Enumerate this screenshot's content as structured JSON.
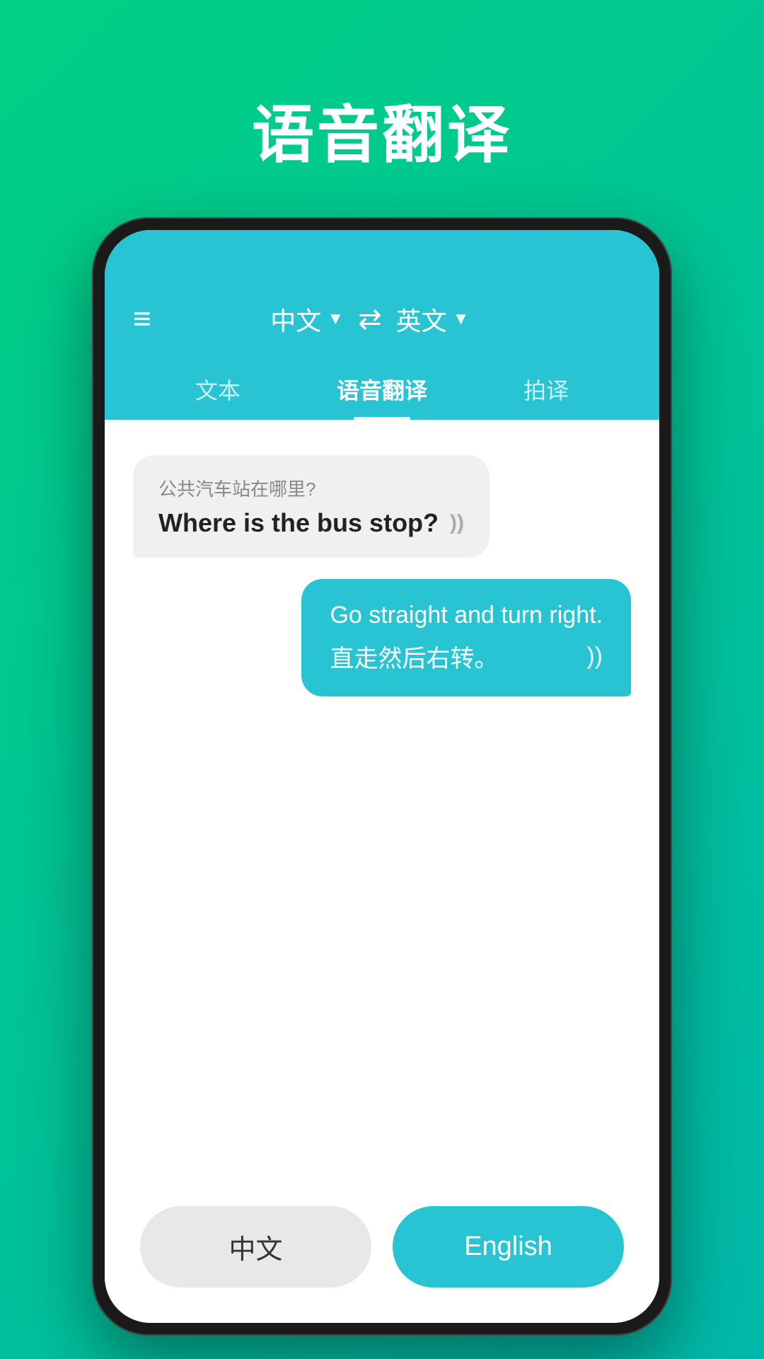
{
  "page": {
    "title": "语音翻译",
    "background_color_start": "#00d084",
    "background_color_end": "#00b8a9"
  },
  "header": {
    "source_lang": "中文",
    "target_lang": "英文",
    "dropdown_arrow": "▼",
    "swap_label": "swap-icon"
  },
  "tabs": [
    {
      "id": "text",
      "label": "文本",
      "active": false
    },
    {
      "id": "voice",
      "label": "语音翻译",
      "active": true
    },
    {
      "id": "photo",
      "label": "拍译",
      "active": false
    }
  ],
  "messages": [
    {
      "id": "msg1",
      "direction": "left",
      "source_text": "公共汽车站在哪里?",
      "translated_text": "Where is the bus stop?",
      "has_sound": true
    },
    {
      "id": "msg2",
      "direction": "right",
      "source_text": "Go straight and turn right.",
      "translated_text": "直走然后右转。",
      "has_sound": true
    }
  ],
  "bottom_buttons": {
    "chinese_label": "中文",
    "english_label": "English"
  },
  "icons": {
    "hamburger": "≡",
    "swap": "⇄",
    "sound": "◁))",
    "sound_alt": "))"
  }
}
